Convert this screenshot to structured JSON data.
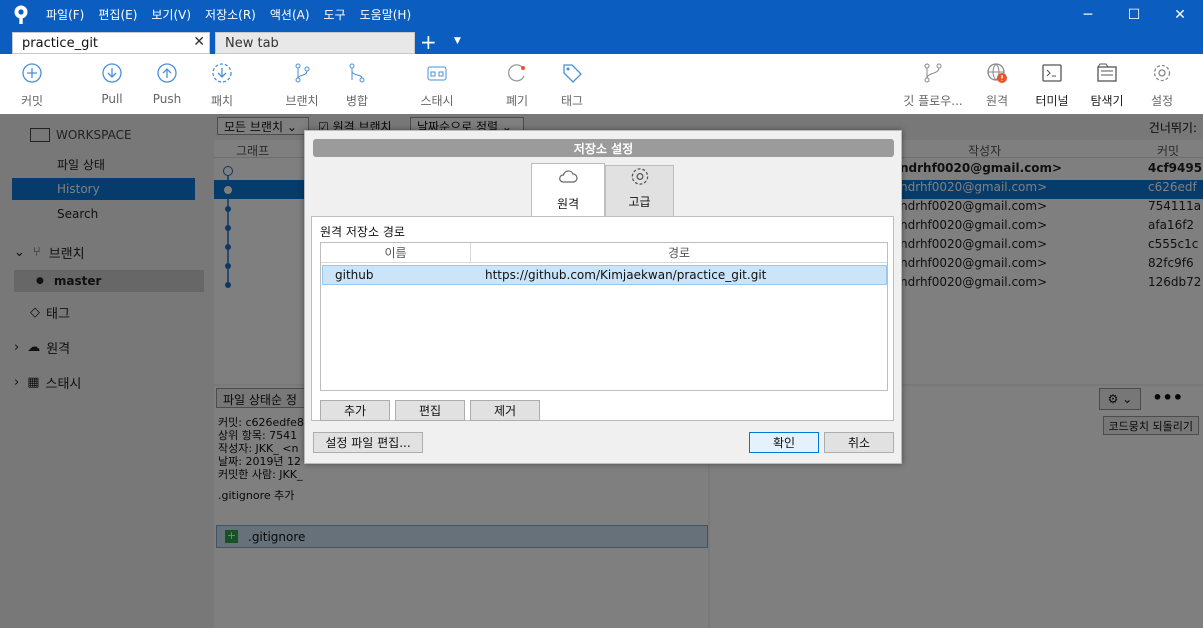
{
  "menu": [
    "파일(F)",
    "편집(E)",
    "보기(V)",
    "저장소(R)",
    "액션(A)",
    "도구",
    "도움말(H)"
  ],
  "window": {
    "minimize": "─",
    "maximize": "☐",
    "close": "✕"
  },
  "tabs": {
    "active": "practice_git",
    "close": "✕",
    "second": "New tab",
    "plus": "+",
    "dropdown": "▼"
  },
  "toolbar": {
    "commit": "커밋",
    "pull": "Pull",
    "push": "Push",
    "fetch": "패치",
    "branch": "브랜치",
    "merge": "병합",
    "stash": "스태시",
    "discard": "폐기",
    "tag": "태그",
    "gitflow": "깃 플로우...",
    "remote": "원격",
    "terminal": "터미널",
    "explorer": "탐색기",
    "settings": "설정"
  },
  "sidebar": {
    "workspace": "WORKSPACE",
    "file_status": "파일 상태",
    "history": "History",
    "search": "Search",
    "branches": "브랜치",
    "master": "master",
    "tags": "태그",
    "remotes": "원격",
    "stashes": "스태시"
  },
  "filterbar": {
    "all_branches": "모든 브랜치",
    "remote_branches": "원격 브랜치",
    "sort": "날짜순으로 정렬",
    "jump": "건너뛰기:"
  },
  "columns": {
    "graph": "그래프",
    "author": "작성자",
    "commit": "커밋"
  },
  "commits": [
    {
      "author": "ndrhf0020@gmail.com>",
      "hash": "4cf9495"
    },
    {
      "author": "ndrhf0020@gmail.com>",
      "hash": "c626edf"
    },
    {
      "author": "ndrhf0020@gmail.com>",
      "hash": "754111a"
    },
    {
      "author": "ndrhf0020@gmail.com>",
      "hash": "afa16f2"
    },
    {
      "author": "ndrhf0020@gmail.com>",
      "hash": "c555c1c"
    },
    {
      "author": "ndrhf0020@gmail.com>",
      "hash": "82fc9f6"
    },
    {
      "author": "ndrhf0020@gmail.com>",
      "hash": "126db72"
    }
  ],
  "details": {
    "sort_label": "파일 상태순 정",
    "commit_line": "커밋: c626edfe8",
    "parent_line": "상위 항목: 7541",
    "author_line": "작성자: JKK_ <n",
    "date_line": "날짜: 2019년 12",
    "committer_line": "커밋한 사람: JKK_",
    "message": ".gitignore 추가",
    "file": ".gitignore",
    "revert": "코드뭉치 되돌리기"
  },
  "dialog": {
    "title": "저장소 설정",
    "tab_remote": "원격",
    "tab_advanced": "고급",
    "panel_label": "원격 저장소 경로",
    "col_name": "이름",
    "col_path": "경로",
    "rows": [
      {
        "name": "github",
        "path": "https://github.com/Kimjaekwan/practice_git.git"
      }
    ],
    "add": "추가",
    "edit": "편집",
    "remove": "제거",
    "edit_config": "설정 파일 편집...",
    "ok": "확인",
    "cancel": "취소"
  },
  "colors": {
    "accent": "#0b5ec0",
    "selection": "#0078d7",
    "badge": "#e8542d"
  }
}
